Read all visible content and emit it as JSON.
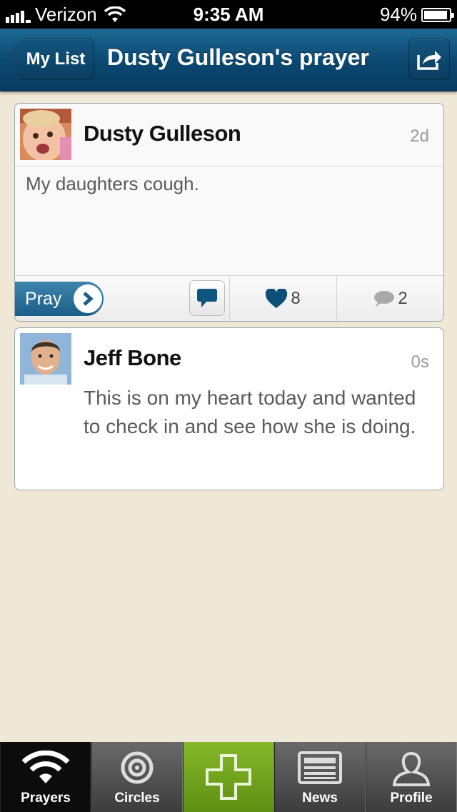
{
  "status_bar": {
    "carrier": "Verizon",
    "time": "9:35 AM",
    "battery": "94%",
    "battery_level": 0.94
  },
  "nav": {
    "back_label": "My List",
    "title": "Dusty Gulleson's prayer"
  },
  "prayer": {
    "author": "Dusty Gulleson",
    "age": "2d",
    "text": "My daughters cough.",
    "pray_label": "Pray",
    "likes": "8",
    "comments": "2"
  },
  "reply": {
    "author": "Jeff Bone",
    "age": "0s",
    "text": "This is on my heart today and wanted to check in and see how she is doing."
  },
  "tabs": [
    {
      "label": "Prayers",
      "icon": "wifi-icon"
    },
    {
      "label": "Circles",
      "icon": "target-icon"
    },
    {
      "label": "",
      "icon": "plus-icon"
    },
    {
      "label": "News",
      "icon": "newspaper-icon"
    },
    {
      "label": "Profile",
      "icon": "person-icon"
    }
  ],
  "colors": {
    "nav": "#0b4770",
    "background": "#efe8d6",
    "add_tab": "#6fa31a"
  }
}
